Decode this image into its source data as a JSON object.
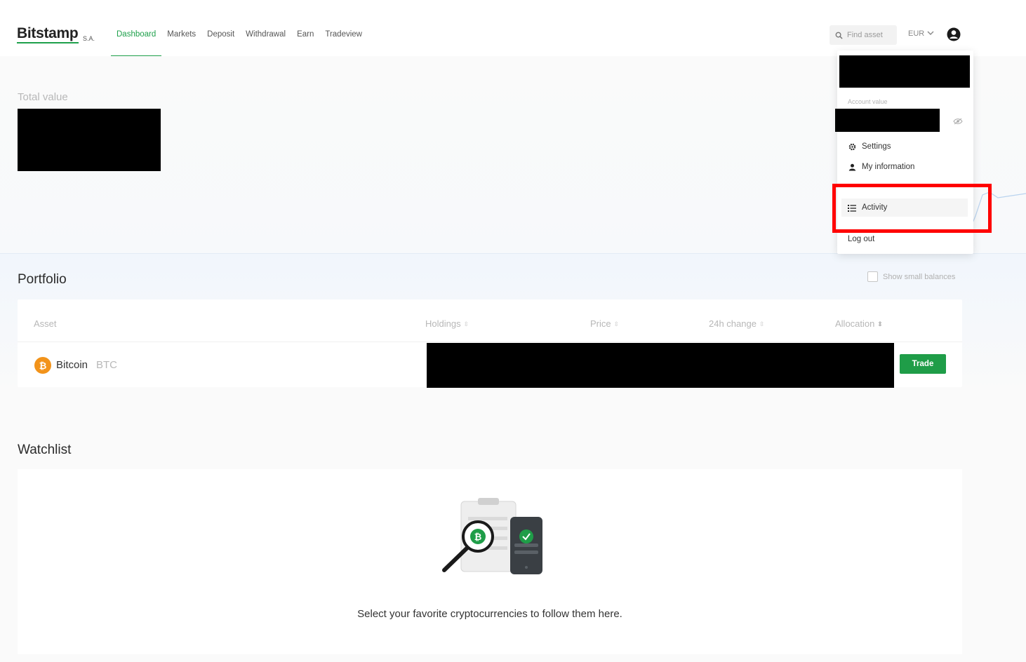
{
  "brand": {
    "name": "Bitstamp",
    "suffix": "S.A.",
    "accent_color": "#1ea04b"
  },
  "nav": {
    "items": [
      {
        "label": "Dashboard",
        "active": true
      },
      {
        "label": "Markets",
        "active": false
      },
      {
        "label": "Deposit",
        "active": false
      },
      {
        "label": "Withdrawal",
        "active": false
      },
      {
        "label": "Earn",
        "active": false
      },
      {
        "label": "Tradeview",
        "active": false
      }
    ]
  },
  "header": {
    "search_placeholder": "Find asset",
    "currency": "EUR",
    "user_icon": "user-circle-icon"
  },
  "overview": {
    "total_value_label": "Total value"
  },
  "portfolio": {
    "title": "Portfolio",
    "show_small_balances_label": "Show small balances",
    "show_small_balances_checked": false,
    "columns": [
      "Asset",
      "Holdings",
      "Price",
      "24h change",
      "Allocation"
    ],
    "rows": [
      {
        "name": "Bitcoin",
        "ticker": "BTC",
        "icon": "bitcoin-icon",
        "action": "Trade"
      }
    ]
  },
  "watchlist": {
    "title": "Watchlist",
    "empty_message": "Select your favorite cryptocurrencies to follow them here."
  },
  "user_menu": {
    "account_value_label": "Account value",
    "items": [
      {
        "label": "Settings",
        "icon": "gear-icon"
      },
      {
        "label": "My information",
        "icon": "person-icon"
      },
      {
        "label": "Activity",
        "icon": "list-icon",
        "highlighted": true
      },
      {
        "label": "Log out",
        "icon": ""
      }
    ]
  },
  "colors": {
    "trade_button": "#1f9d48",
    "bitcoin": "#f2931a",
    "highlight": "#ff0000"
  }
}
